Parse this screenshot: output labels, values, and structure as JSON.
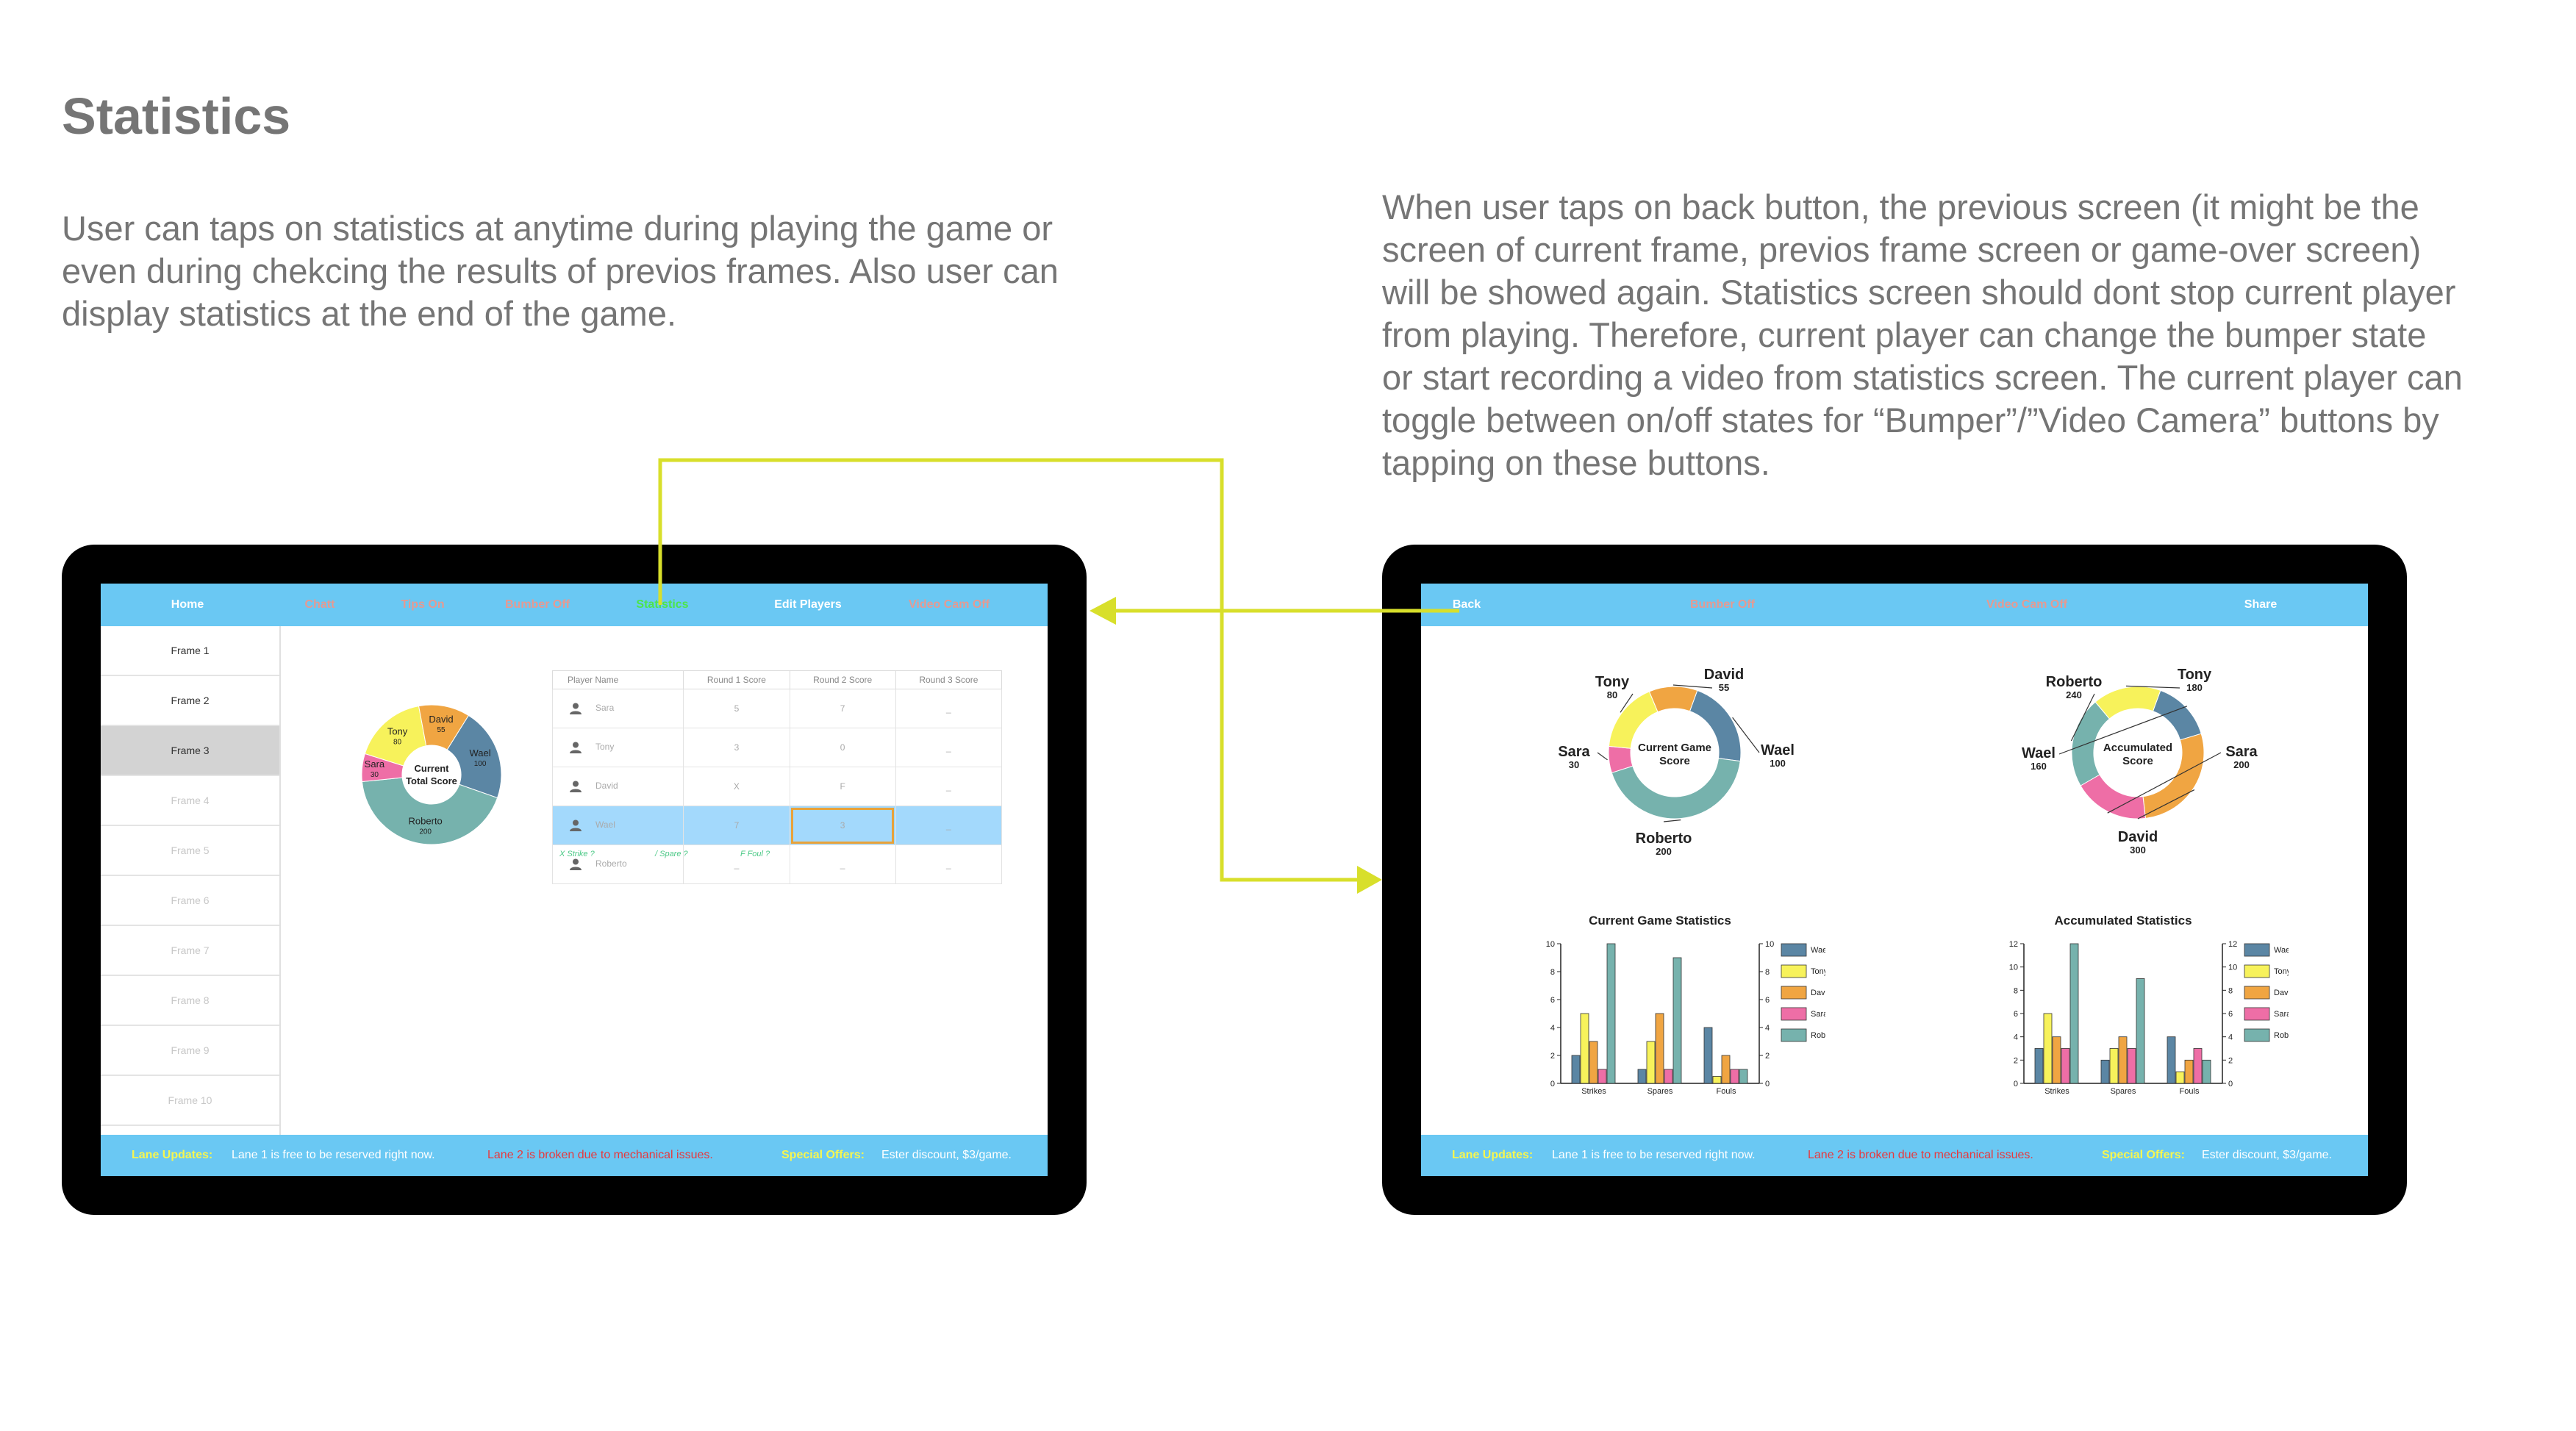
{
  "page": {
    "title": "Statistics",
    "desc_left": "User can taps on statistics at anytime during playing the game or even during chekcing the results of previos frames. Also user can display statistics at the end of the game.",
    "desc_right": "When user taps on back button, the previous screen (it might be the screen of current frame, previos frame screen or game-over screen) will be showed again. Statistics screen should dont stop current player from playing. Therefore, current player can change the bumper state or start recording a video from statistics screen. The current player can toggle between on/off states for “Bumper”/”Video Camera” buttons by tapping on these buttons."
  },
  "colors": {
    "nav_bg": "#6ac8f3",
    "wael": "#5b86a4",
    "tony": "#f7f25b",
    "david": "#f0a542",
    "sara": "#ee6ea6",
    "roberto": "#76b2ad",
    "connector": "#d8df2b",
    "highlight_row": "#a3d9fc"
  },
  "left_screen": {
    "nav": [
      "Home",
      "Chatt",
      "Tips On",
      "Bumber Off",
      "Statistics",
      "Edit Players",
      "Video Cam Off"
    ],
    "frames": [
      "Frame 1",
      "Frame 2",
      "Frame 3",
      "Frame 4",
      "Frame 5",
      "Frame 6",
      "Frame 7",
      "Frame 8",
      "Frame 9",
      "Frame 10"
    ],
    "selected_frame": "Frame 3",
    "donut": {
      "center_line1": "Current",
      "center_line2": "Total Score",
      "slices": [
        {
          "name": "Wael",
          "value": "100"
        },
        {
          "name": "Roberto",
          "value": "200"
        },
        {
          "name": "Sara",
          "value": "30"
        },
        {
          "name": "Tony",
          "value": "80"
        },
        {
          "name": "David",
          "value": "55"
        }
      ]
    },
    "table": {
      "headers": [
        "Player Name",
        "Round 1 Score",
        "Round 2 Score",
        "Round 3 Score"
      ],
      "rows": [
        {
          "name": "Sara",
          "r1": "5",
          "r2": "7",
          "r3": "_"
        },
        {
          "name": "Tony",
          "r1": "3",
          "r2": "0",
          "r3": "_"
        },
        {
          "name": "David",
          "r1": "X",
          "r2": "F",
          "r3": "_"
        },
        {
          "name": "Wael",
          "r1": "7",
          "r2": "3",
          "r3": "_"
        },
        {
          "name": "Roberto",
          "r1": "_",
          "r2": "_",
          "r3": "_"
        }
      ]
    },
    "keys": [
      "X Strike  ?",
      "/ Spare  ?",
      "F Foul  ?"
    ]
  },
  "right_screen": {
    "nav": [
      "Back",
      "Bumber Off",
      "Video Cam Off",
      "Share"
    ],
    "donut_current": {
      "center_line1": "Current Game",
      "center_line2": "Score",
      "labels": [
        {
          "name": "Tony",
          "value": "80"
        },
        {
          "name": "David",
          "value": "55"
        },
        {
          "name": "Sara",
          "value": "30"
        },
        {
          "name": "Wael",
          "value": "100"
        },
        {
          "name": "Roberto",
          "value": "200"
        }
      ]
    },
    "donut_accumulated": {
      "center_line1": "Accumulated",
      "center_line2": "Score",
      "labels": [
        {
          "name": "Roberto",
          "value": "240"
        },
        {
          "name": "Tony",
          "value": "180"
        },
        {
          "name": "Wael",
          "value": "160"
        },
        {
          "name": "Sara",
          "value": "200"
        },
        {
          "name": "David",
          "value": "300"
        }
      ]
    }
  },
  "footer": {
    "lane_label": "Lane Updates:",
    "lane_free": "Lane 1 is free to be reserved right now.",
    "lane_broken": "Lane 2 is broken due to mechanical issues.",
    "offers_label": "Special Offers:",
    "offers_text": "Ester  discount, $3/game."
  },
  "chart_data": [
    {
      "type": "pie",
      "title": "",
      "center_text": "Current Total Score",
      "categories": [
        "Wael",
        "Roberto",
        "Sara",
        "Tony",
        "David"
      ],
      "values": [
        100,
        200,
        30,
        80,
        55
      ]
    },
    {
      "type": "pie",
      "title": "",
      "center_text": "Current Game Score",
      "categories": [
        "Wael",
        "Roberto",
        "Sara",
        "Tony",
        "David"
      ],
      "values": [
        100,
        200,
        30,
        80,
        55
      ]
    },
    {
      "type": "pie",
      "title": "",
      "center_text": "Accumulated Score",
      "categories": [
        "Wael",
        "David",
        "Sara",
        "Roberto",
        "Tony"
      ],
      "values": [
        160,
        300,
        200,
        240,
        180
      ]
    },
    {
      "type": "bar",
      "title": "Current Game Statistics",
      "categories": [
        "Strikes",
        "Spares",
        "Fouls"
      ],
      "ylim": [
        0,
        10
      ],
      "yticks": [
        0,
        2,
        4,
        6,
        8,
        10
      ],
      "legend": "right",
      "series": [
        {
          "name": "Wael",
          "values": [
            2,
            1,
            4
          ]
        },
        {
          "name": "Tony",
          "values": [
            5,
            3,
            0.5
          ]
        },
        {
          "name": "David",
          "values": [
            3,
            5,
            2
          ]
        },
        {
          "name": "Sara",
          "values": [
            1,
            1,
            1
          ]
        },
        {
          "name": "Roberto",
          "values": [
            10,
            9,
            1
          ]
        }
      ]
    },
    {
      "type": "bar",
      "title": "Accumulated Statistics",
      "categories": [
        "Strikes",
        "Spares",
        "Fouls"
      ],
      "ylim": [
        0,
        12
      ],
      "yticks": [
        0,
        2,
        4,
        6,
        8,
        10,
        12
      ],
      "legend": "right",
      "series": [
        {
          "name": "Wael",
          "values": [
            3,
            2,
            4
          ]
        },
        {
          "name": "Tony",
          "values": [
            6,
            3,
            1
          ]
        },
        {
          "name": "David",
          "values": [
            4,
            4,
            2
          ]
        },
        {
          "name": "Sara",
          "values": [
            3,
            3,
            3
          ]
        },
        {
          "name": "Roberto",
          "values": [
            12,
            9,
            2
          ]
        }
      ]
    }
  ]
}
